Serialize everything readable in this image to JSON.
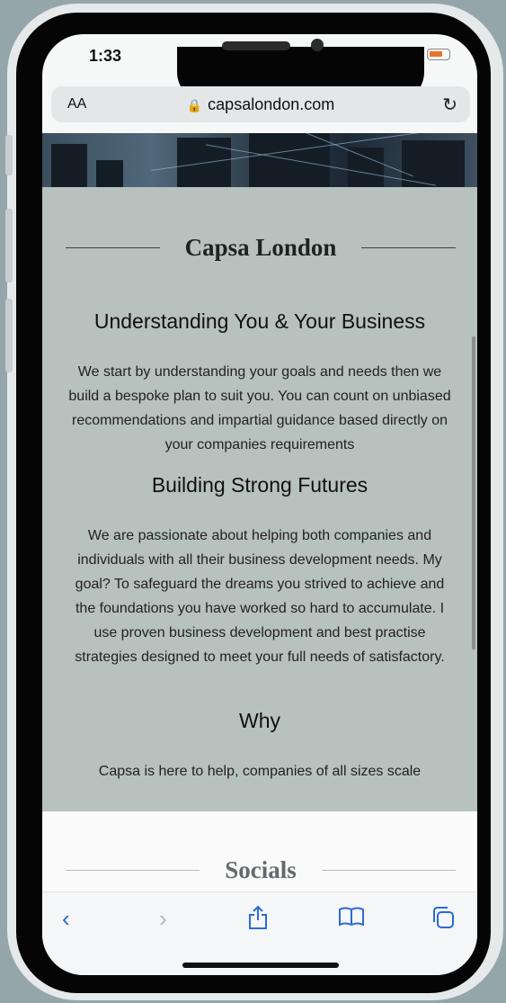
{
  "status_bar": {
    "time": "1:33"
  },
  "browser": {
    "text_size_label": "AA",
    "url": "capsalondon.com"
  },
  "page": {
    "brand_title": "Capsa London",
    "sections": [
      {
        "heading": "Understanding You & Your Business",
        "body": "We start by understanding your goals and needs then we build a bespoke plan to suit you. You can count on unbiased recommendations and impartial guidance based directly on your companies requirements"
      },
      {
        "heading": "Building Strong Futures",
        "body": "We are passionate about helping both companies and individuals with all their business development needs. My goal? To safeguard the dreams you strived to achieve and the foundations you have worked so hard to accumulate. I use proven business development and best practise strategies designed to meet your full needs of satisfactory."
      },
      {
        "heading": "Why",
        "body": "Capsa is here to help, companies of all sizes scale"
      }
    ],
    "socials_title": "Socials"
  },
  "colors": {
    "content_bg": "#b7c1bd",
    "link_blue": "#2a6bd6",
    "battery_orange": "#e8742b"
  },
  "icons": [
    "lock-icon",
    "reload-icon",
    "signal-icon",
    "wifi-icon",
    "battery-icon",
    "back-icon",
    "forward-icon",
    "share-icon",
    "bookmarks-icon",
    "tabs-icon"
  ]
}
